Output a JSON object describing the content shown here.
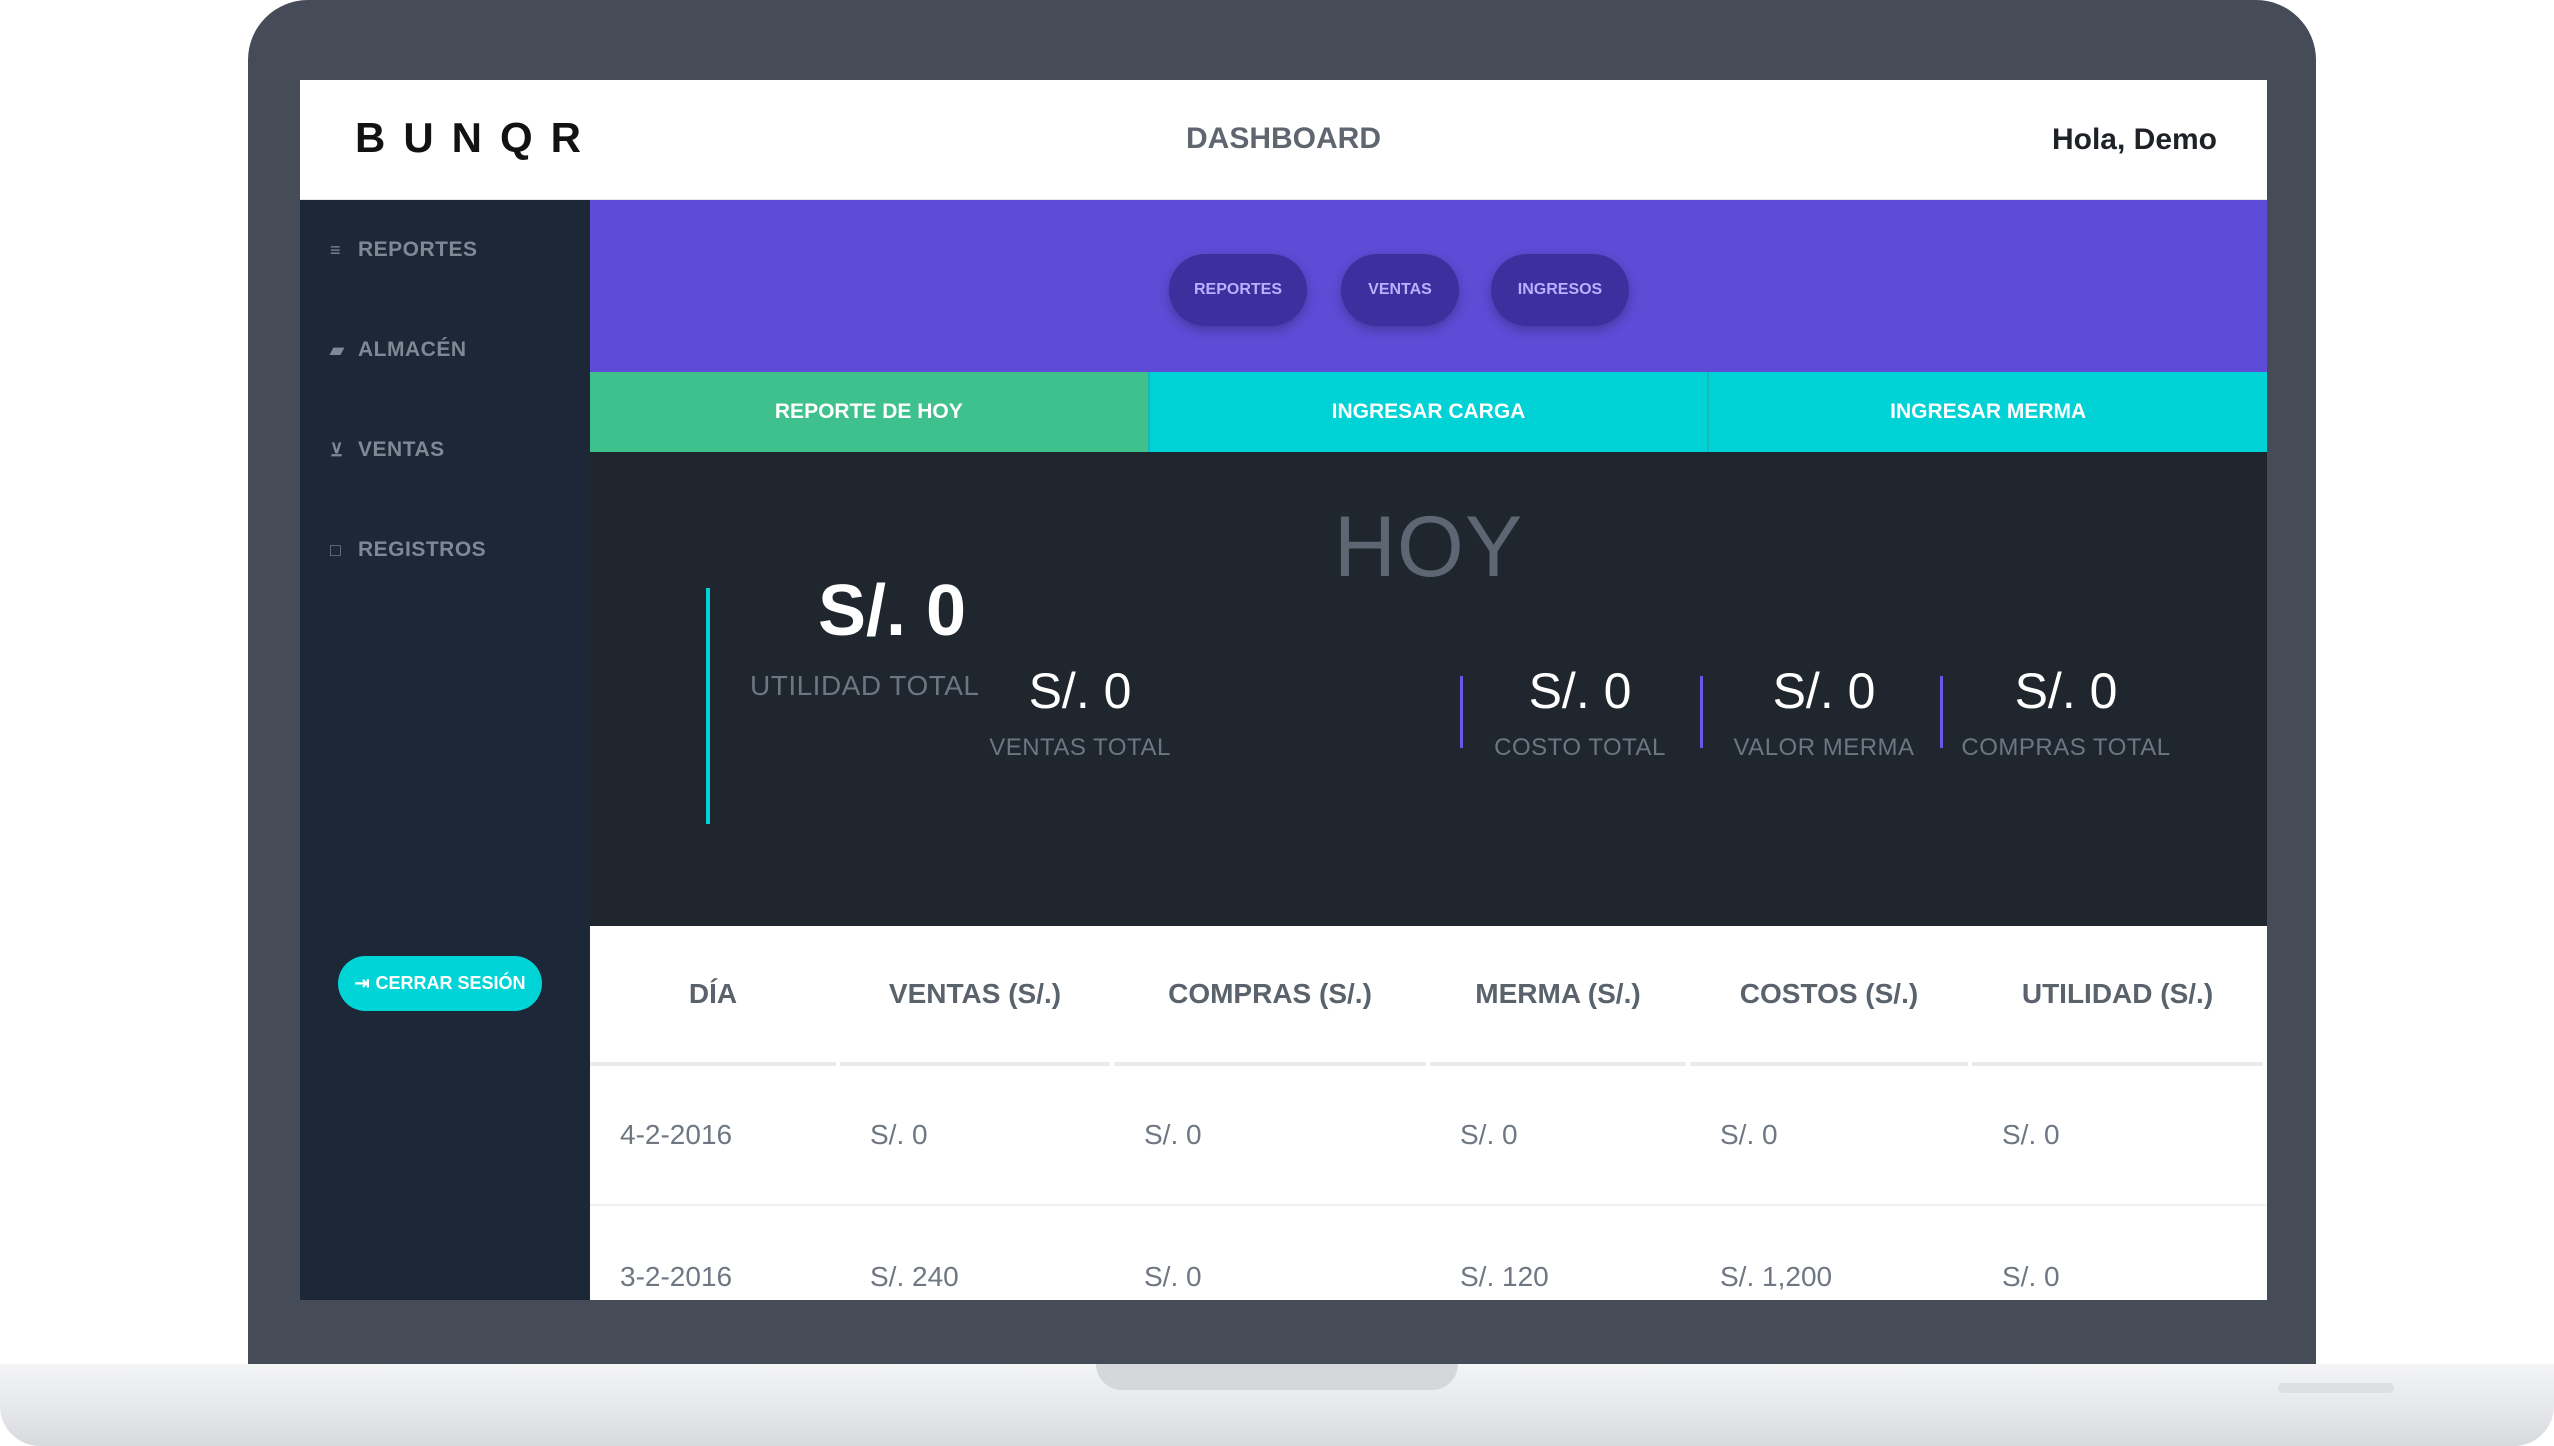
{
  "header": {
    "brand": "BUNQR",
    "title": "DASHBOARD",
    "greeting": "Hola, Demo"
  },
  "sidebar": {
    "items": [
      {
        "label": "REPORTES",
        "icon": "list-icon"
      },
      {
        "label": "ALMACÉN",
        "icon": "truck-icon"
      },
      {
        "label": "VENTAS",
        "icon": "cart-icon"
      },
      {
        "label": "REGISTROS",
        "icon": "laptop-icon"
      }
    ],
    "logout_label": "CERRAR SESIÓN"
  },
  "top_pills": [
    "REPORTES",
    "VENTAS",
    "INGRESOS"
  ],
  "tabs": [
    "REPORTE DE HOY",
    "INGRESAR CARGA",
    "INGRESAR MERMA"
  ],
  "stats": {
    "heading": "HOY",
    "main": {
      "value": "S/. 0",
      "label": "UTILIDAD TOTAL"
    },
    "items": [
      {
        "value": "S/. 0",
        "label": "VENTAS TOTAL"
      },
      {
        "value": "S/. 0",
        "label": "COSTO TOTAL"
      },
      {
        "value": "S/. 0",
        "label": "VALOR MERMA"
      },
      {
        "value": "S/. 0",
        "label": "COMPRAS TOTAL"
      }
    ]
  },
  "table": {
    "headers": [
      "DÍA",
      "VENTAS (S/.)",
      "COMPRAS (S/.)",
      "MERMA (S/.)",
      "COSTOS (S/.)",
      "UTILIDAD (S/.)"
    ],
    "rows": [
      [
        "4-2-2016",
        "S/. 0",
        "S/. 0",
        "S/. 0",
        "S/. 0",
        "S/. 0"
      ],
      [
        "3-2-2016",
        "S/. 240",
        "S/. 0",
        "S/. 120",
        "S/. 1,200",
        "S/. 0"
      ]
    ]
  },
  "colors": {
    "purple": "#5e4bd6",
    "green": "#3ec18d",
    "cyan": "#00d2d6",
    "sidebar": "#1c2837",
    "panel": "#20262e"
  }
}
